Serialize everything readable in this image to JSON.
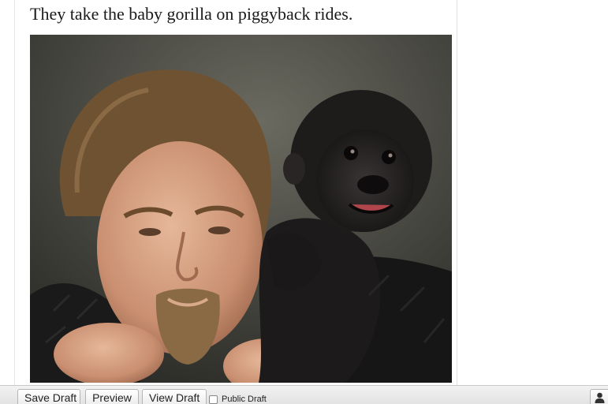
{
  "article": {
    "caption": "They take the baby gorilla on piggyback rides."
  },
  "photo": {
    "subject": "man-carrying-baby-gorilla"
  },
  "toolbar": {
    "save_draft": "Save Draft",
    "preview": "Preview",
    "view_draft": "View Draft",
    "public_draft_label": "Public Draft",
    "public_draft_checked": false,
    "user_icon": "user-icon"
  }
}
